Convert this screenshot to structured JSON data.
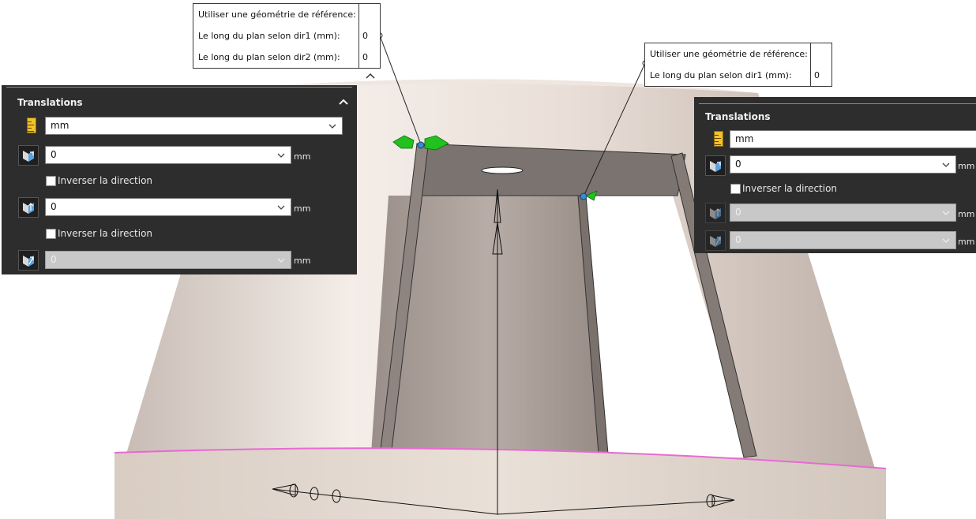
{
  "callout_left": {
    "rows": [
      {
        "label": "Utiliser une géométrie de référence:",
        "value": ""
      },
      {
        "label": "Le long du plan selon dir1 (mm):",
        "value": "0"
      },
      {
        "label": "Le long du plan selon dir2 (mm):",
        "value": "0"
      }
    ]
  },
  "callout_right": {
    "rows": [
      {
        "label": "Utiliser une géométrie de référence:",
        "value": ""
      },
      {
        "label": "Le long du plan selon dir1 (mm):",
        "value": "0"
      }
    ]
  },
  "panel_left": {
    "title": "Translations",
    "unit_select": "mm",
    "field1": {
      "value": "0",
      "unit": "mm"
    },
    "reverse1": {
      "label": "Inverser la direction",
      "checked": false
    },
    "field2": {
      "value": "0",
      "unit": "mm"
    },
    "reverse2": {
      "label": "Inverser la direction",
      "checked": false
    },
    "field3": {
      "value": "0",
      "unit": "mm",
      "disabled": true
    }
  },
  "panel_right": {
    "title": "Translations",
    "unit_select": "mm",
    "field1": {
      "value": "0",
      "unit": "mm"
    },
    "reverse1": {
      "label": "Inverser la direction",
      "checked": false
    },
    "field2": {
      "value": "0",
      "unit": "mm",
      "disabled": true
    },
    "field3": {
      "value": "0",
      "unit": "mm",
      "disabled": true
    }
  },
  "colors": {
    "panel_bg": "#2d2d2d",
    "body_color": "#d8ccc6",
    "slot_color": "#8a7f7a",
    "handle_green": "#22c11f",
    "point_blue": "#3b8ad6",
    "edge_pink": "#e86ad2"
  },
  "icons": [
    "ruler-icon",
    "direction-x-icon",
    "direction-y-icon",
    "direction-z-icon",
    "chevron-down-icon",
    "chevron-up-icon",
    "checkbox"
  ]
}
